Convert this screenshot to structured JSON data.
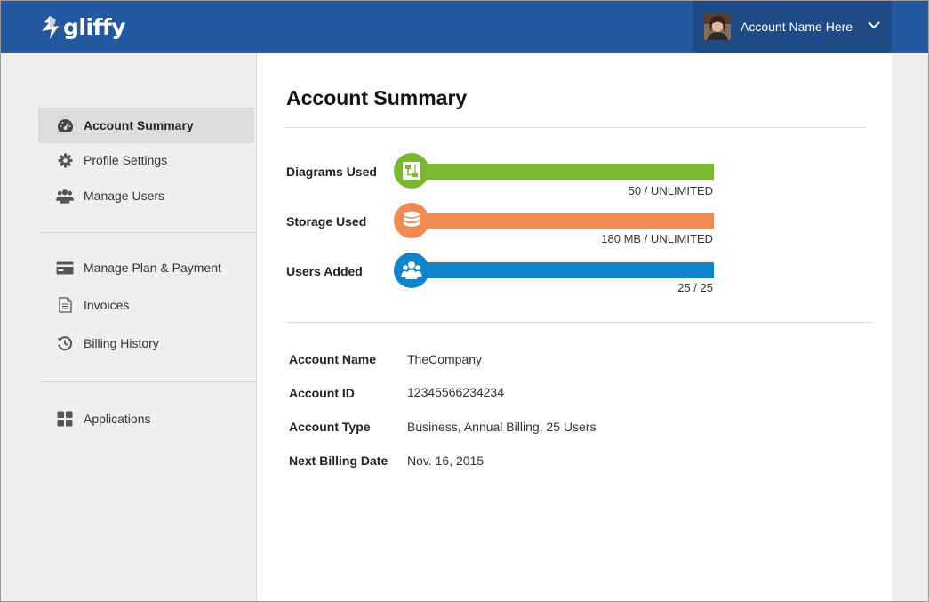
{
  "header": {
    "logo_text": "gliffy",
    "account_name": "Account Name Here"
  },
  "sidebar": {
    "items": [
      {
        "label": "Account Summary",
        "icon": "dashboard-icon",
        "active": true
      },
      {
        "label": "Profile Settings",
        "icon": "gear-icon"
      },
      {
        "label": "Manage Users",
        "icon": "users-icon"
      },
      {
        "label": "Manage Plan & Payment",
        "icon": "credit-card-icon"
      },
      {
        "label": "Invoices",
        "icon": "document-icon"
      },
      {
        "label": "Billing History",
        "icon": "history-icon"
      },
      {
        "label": "Applications",
        "icon": "apps-grid-icon"
      }
    ]
  },
  "main": {
    "title": "Account Summary",
    "usage": [
      {
        "label": "Diagrams Used",
        "value": "50 / UNLIMITED",
        "color": "#7cb82f",
        "icon": "diagram-icon"
      },
      {
        "label": "Storage Used",
        "value": "180 MB / UNLIMITED",
        "color": "#ef8a55",
        "icon": "database-icon"
      },
      {
        "label": "Users Added",
        "value": "25 / 25",
        "color": "#0f84c8",
        "icon": "group-icon"
      }
    ],
    "details": [
      {
        "key": "Account Name",
        "value": "TheCompany"
      },
      {
        "key": "Account ID",
        "value": "12345566234234"
      },
      {
        "key": "Account Type",
        "value": "Business, Annual Billing, 25 Users"
      },
      {
        "key": "Next Billing Date",
        "value": "Nov. 16, 2015"
      }
    ]
  },
  "colors": {
    "header_bg": "#2357a0",
    "account_menu_bg": "#1e4a88",
    "sidebar_active_bg": "#dcdcdc"
  }
}
